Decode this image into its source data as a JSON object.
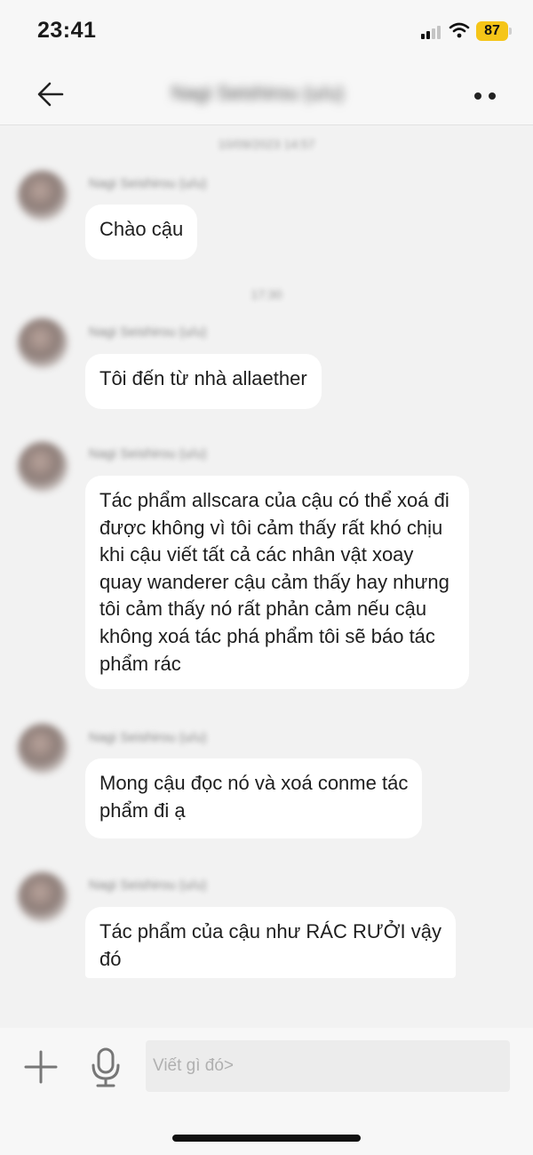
{
  "status_bar": {
    "time": "23:41",
    "battery": "87"
  },
  "header": {
    "title": "Nagi Seishirou (u/u)"
  },
  "messages": [
    {
      "date": "10/09/2023 14:57",
      "sender": "Nagi Seishirou (u/u)",
      "text": "Chào cậu"
    },
    {
      "date": "17:30",
      "sender": "Nagi Seishirou (u/u)",
      "text": "Tôi đến từ nhà allaether"
    },
    {
      "date": "",
      "sender": "Nagi Seishirou (u/u)",
      "text": "Tác phẩm allscara của cậu có thể xoá đi\nđược không vì tôi cảm thấy rất khó chịu\nkhi cậu viết tất cả các nhân vật xoay\nquay wanderer cậu cảm thấy hay nhưng\ntôi cảm thấy nó rất phản cảm nếu cậu\nkhông xoá tác phá phẩm tôi sẽ báo tác\nphẩm rác"
    },
    {
      "date": "",
      "sender": "Nagi Seishirou (u/u)",
      "text": "Mong cậu đọc nó và xoá conme tác\nphẩm đi ạ"
    },
    {
      "date": "",
      "sender": "Nagi Seishirou (u/u)",
      "text": "Tác phẩm của cậu như RÁC RƯỞI vậy\nđó"
    }
  ],
  "composer": {
    "placeholder": "Viết gì đó>"
  },
  "icons": {
    "back": "arrow-left-icon",
    "more": "more-dots-icon",
    "add": "plus-icon",
    "mic": "microphone-icon"
  },
  "colors": {
    "battery": "#f5c518",
    "bubble": "#ffffff",
    "background": "#f2f2f2"
  }
}
